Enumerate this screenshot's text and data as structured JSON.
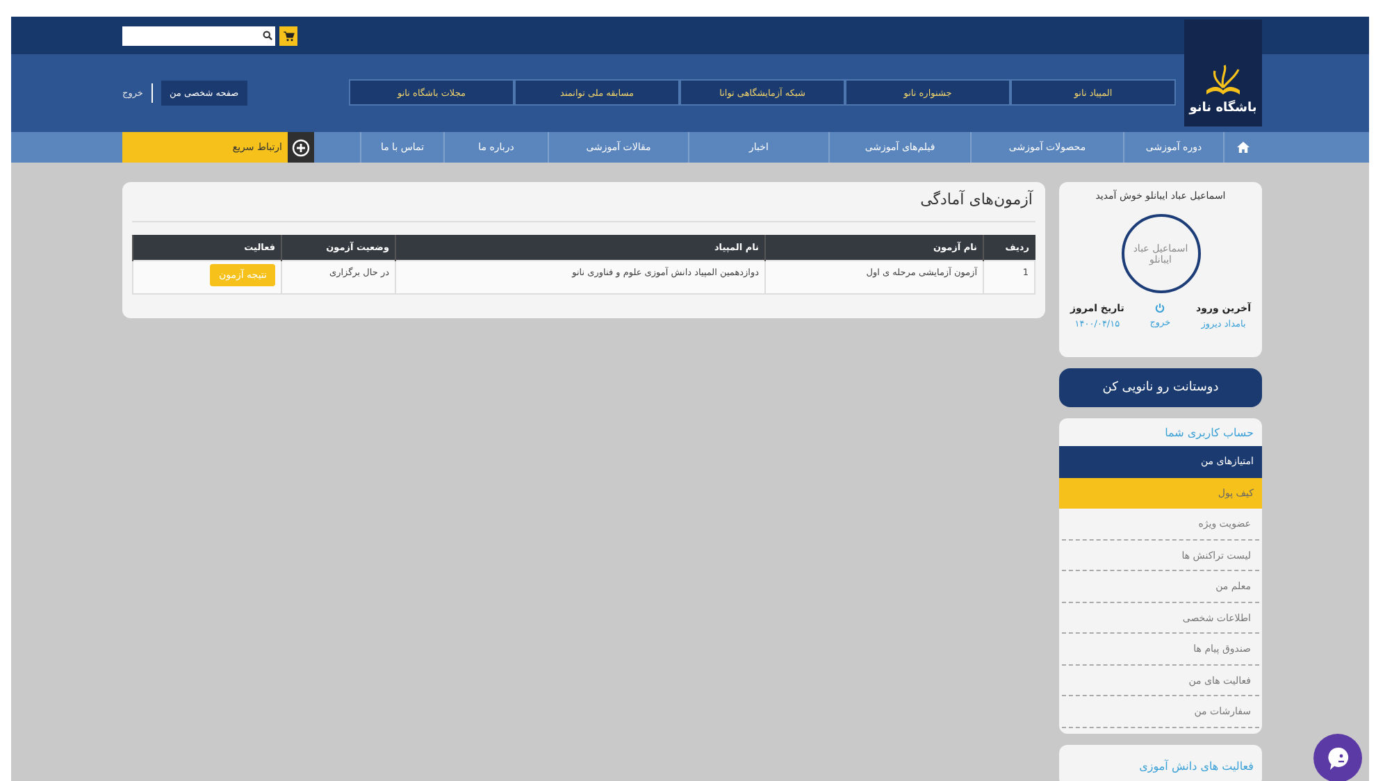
{
  "header": {
    "logo_text": "باشگاه نانو",
    "links": [
      "المپیاد نانو",
      "جشنواره نانو",
      "شبکه آزمایشگاهی توانا",
      "مسابقه ملی توانمند",
      "مجلات باشگاه نانو"
    ],
    "profile_button": "صفحه شخصی من",
    "logout": "خروج"
  },
  "nav": {
    "items": [
      "دوره آموزشی",
      "محصولات آموزشی",
      "فیلم‌های آموزشی",
      "اخبار",
      "مقالات آموزشی",
      "درباره ما",
      "تماس با ما"
    ],
    "quick_contact": "ارتباط سریع"
  },
  "exams": {
    "title": "آزمون‌های آمادگی",
    "columns": [
      "ردیف",
      "نام آزمون",
      "نام المپیاد",
      "وضعیت آزمون",
      "فعالیت"
    ],
    "rows": [
      {
        "index": "1",
        "exam": "آزمون آزمایشی مرحله ی اول",
        "olympiad": "دوازدهمین المپیاد دانش آموزی علوم و فناوری نانو",
        "status": "در حال برگزاری",
        "action": "نتیجه آزمون"
      }
    ]
  },
  "profile": {
    "welcome": "اسماعیل عباد ایبانلو خوش آمدید",
    "avatar_alt": "اسماعیل عباد ایبانلو",
    "last_login_label": "آخرین ورود",
    "last_login_value": "بامداد دیروز",
    "logout": "خروج",
    "today_label": "تاریخ امروز",
    "today_value": "۱۴۰۰/۰۴/۱۵"
  },
  "invite_button": "دوستانت رو نانویی کن",
  "account": {
    "title": "حساب کاربری شما",
    "items": [
      {
        "label": "امتیازهای من",
        "selected": true,
        "highlighted": false
      },
      {
        "label": "کیف پول",
        "selected": false,
        "highlighted": true
      },
      {
        "label": "عضویت ویژه",
        "selected": false,
        "highlighted": false
      },
      {
        "label": "لیست تراکنش ها",
        "selected": false,
        "highlighted": false
      },
      {
        "label": "معلم من",
        "selected": false,
        "highlighted": false
      },
      {
        "label": "اطلاعات شخصی",
        "selected": false,
        "highlighted": false
      },
      {
        "label": "صندوق پیام ها",
        "selected": false,
        "highlighted": false
      },
      {
        "label": "فعالیت های من",
        "selected": false,
        "highlighted": false
      },
      {
        "label": "سفارشات من",
        "selected": false,
        "highlighted": false
      }
    ]
  },
  "activities_title": "فعالیت های دانش آموزی"
}
